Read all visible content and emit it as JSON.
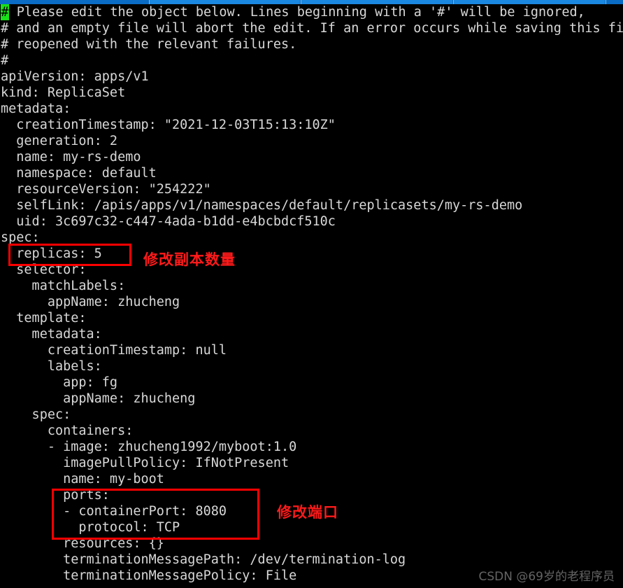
{
  "window": {
    "chrome_color": "#0a6cc4",
    "chrome_tab_color": "#1a87e0"
  },
  "terminal": {
    "background": "#000000",
    "foreground": "#d8d8d8",
    "cursor_color": "#19e019",
    "cursor_char": "#",
    "lines": [
      "# Please edit the object below. Lines beginning with a '#' will be ignored,",
      "# and an empty file will abort the edit. If an error occurs while saving this fil",
      "# reopened with the relevant failures.",
      "#",
      "apiVersion: apps/v1",
      "kind: ReplicaSet",
      "metadata:",
      "  creationTimestamp: \"2021-12-03T15:13:10Z\"",
      "  generation: 2",
      "  name: my-rs-demo",
      "  namespace: default",
      "  resourceVersion: \"254222\"",
      "  selfLink: /apis/apps/v1/namespaces/default/replicasets/my-rs-demo",
      "  uid: 3c697c32-c447-4ada-b1dd-e4bcbdcf510c",
      "spec:",
      "  replicas: 5",
      "  selector:",
      "    matchLabels:",
      "      appName: zhucheng",
      "  template:",
      "    metadata:",
      "      creationTimestamp: null",
      "      labels:",
      "        app: fg",
      "        appName: zhucheng",
      "    spec:",
      "      containers:",
      "      - image: zhucheng1992/myboot:1.0",
      "        imagePullPolicy: IfNotPresent",
      "        name: my-boot",
      "        ports:",
      "        - containerPort: 8080",
      "          protocol: TCP",
      "        resources: {}",
      "        terminationMessagePath: /dev/termination-log",
      "        terminationMessagePolicy: File"
    ]
  },
  "annotations": {
    "color": "#ff1a1a",
    "box_color": "#ff0000",
    "replicas_note": "修改副本数量",
    "ports_note": "修改端口"
  },
  "watermark": {
    "text": "CSDN @69岁的老程序员"
  }
}
